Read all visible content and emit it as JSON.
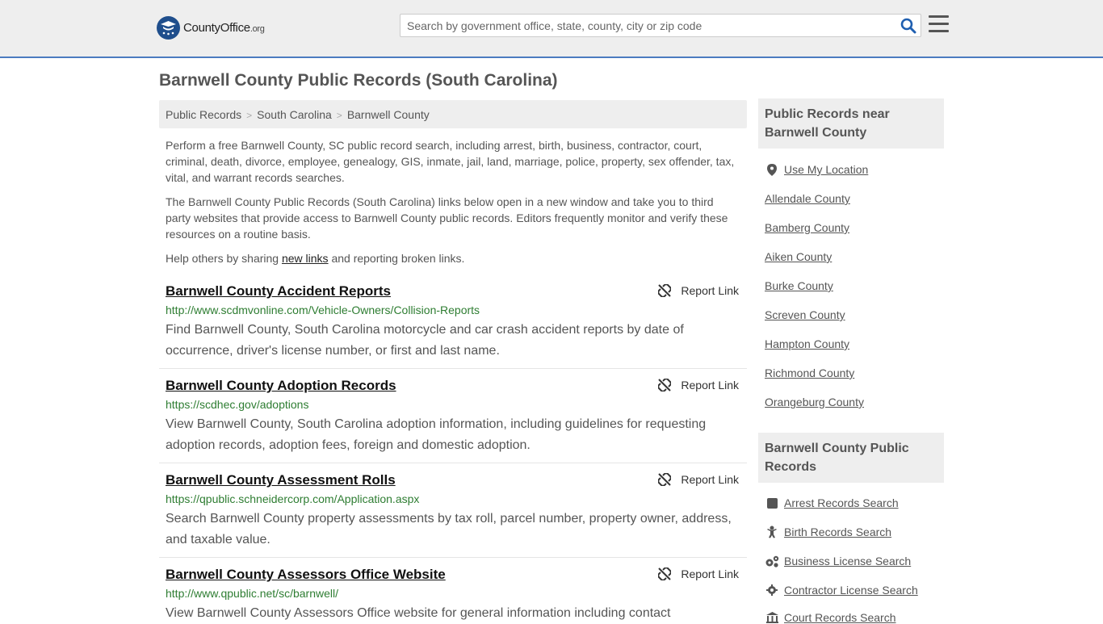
{
  "header": {
    "logo_main": "CountyOffice",
    "logo_tld": ".org",
    "search_placeholder": "Search by government office, state, county, city or zip code"
  },
  "page": {
    "title": "Barnwell County Public Records (South Carolina)"
  },
  "breadcrumb": [
    "Public Records",
    "South Carolina",
    "Barnwell County"
  ],
  "intro": {
    "p1": "Perform a free Barnwell County, SC public record search, including arrest, birth, business, contractor, court, criminal, death, divorce, employee, genealogy, GIS, inmate, jail, land, marriage, police, property, sex offender, tax, vital, and warrant records searches.",
    "p2": "The Barnwell County Public Records (South Carolina) links below open in a new window and take you to third party websites that provide access to Barnwell County public records. Editors frequently monitor and verify these resources on a routine basis.",
    "p3_before": "Help others by sharing ",
    "p3_link": "new links",
    "p3_after": " and reporting broken links."
  },
  "report_label": "Report Link",
  "records": [
    {
      "title": "Barnwell County Accident Reports",
      "url": "http://www.scdmvonline.com/Vehicle-Owners/Collision-Reports",
      "desc": "Find Barnwell County, South Carolina motorcycle and car crash accident reports by date of occurrence, driver's license number, or first and last name."
    },
    {
      "title": "Barnwell County Adoption Records",
      "url": "https://scdhec.gov/adoptions",
      "desc": "View Barnwell County, South Carolina adoption information, including guidelines for requesting adoption records, adoption fees, foreign and domestic adoption."
    },
    {
      "title": "Barnwell County Assessment Rolls",
      "url": "https://qpublic.schneidercorp.com/Application.aspx",
      "desc": "Search Barnwell County property assessments by tax roll, parcel number, property owner, address, and taxable value."
    },
    {
      "title": "Barnwell County Assessors Office Website",
      "url": "http://www.qpublic.net/sc/barnwell/",
      "desc": "View Barnwell County Assessors Office website for general information including contact"
    }
  ],
  "sidebar": {
    "nearby_heading": "Public Records near Barnwell County",
    "use_location": "Use My Location",
    "nearby": [
      "Allendale County",
      "Bamberg County",
      "Aiken County",
      "Burke County",
      "Screven County",
      "Hampton County",
      "Richmond County",
      "Orangeburg County"
    ],
    "county_heading": "Barnwell County Public Records",
    "county_links": [
      {
        "label": "Arrest Records Search",
        "icon": "square-icon"
      },
      {
        "label": "Birth Records Search",
        "icon": "baby-icon"
      },
      {
        "label": "Business License Search",
        "icon": "gears-icon"
      },
      {
        "label": "Contractor License Search",
        "icon": "gear-icon"
      },
      {
        "label": "Court Records Search",
        "icon": "courthouse-icon"
      }
    ]
  }
}
